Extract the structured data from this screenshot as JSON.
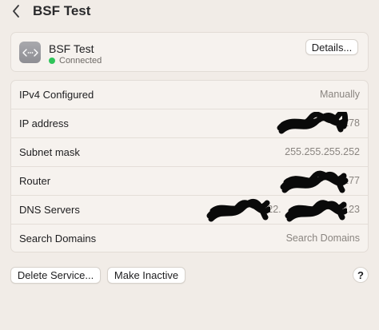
{
  "header": {
    "title": "BSF Test"
  },
  "service": {
    "name": "BSF Test",
    "status": "Connected",
    "status_color": "#30c45a",
    "details_label": "Details..."
  },
  "rows": [
    {
      "label": "IPv4 Configured",
      "value": "Manually"
    },
    {
      "label": "IP address",
      "value": ".178"
    },
    {
      "label": "Subnet mask",
      "value": "255.255.255.252"
    },
    {
      "label": "Router",
      "value": ".177"
    },
    {
      "label": "DNS Servers",
      "value_parts": [
        "122.",
        ".123"
      ]
    },
    {
      "label": "Search Domains",
      "value": "Search Domains"
    }
  ],
  "actions": {
    "delete_label": "Delete Service...",
    "inactive_label": "Make Inactive",
    "help_label": "?"
  }
}
